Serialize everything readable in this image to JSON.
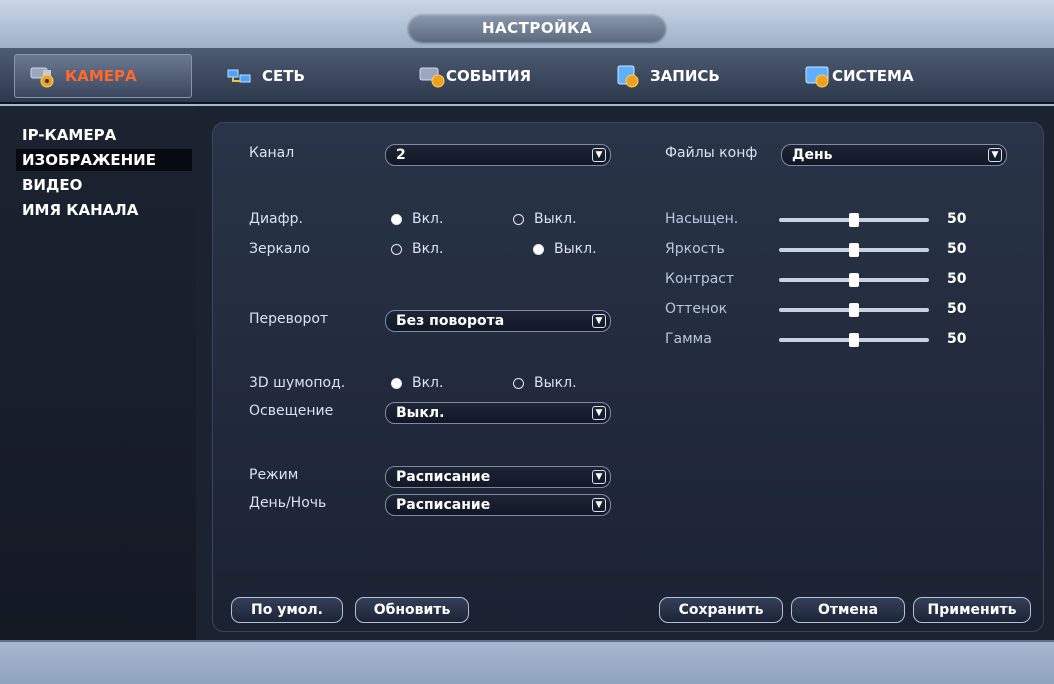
{
  "title": "НАСТРОЙКА",
  "tabs": [
    {
      "label": "КАМЕРА",
      "icon": "camera-icon",
      "active": true
    },
    {
      "label": "СЕТЬ",
      "icon": "network-icon",
      "active": false
    },
    {
      "label": "СОБЫТИЯ",
      "icon": "events-icon",
      "active": false
    },
    {
      "label": "ЗАПИСЬ",
      "icon": "record-icon",
      "active": false
    },
    {
      "label": "СИСТЕМА",
      "icon": "system-icon",
      "active": false
    }
  ],
  "sidebar": {
    "items": [
      {
        "label": "IP-КАМЕРА",
        "active": false
      },
      {
        "label": "ИЗОБРАЖЕНИЕ",
        "active": true
      },
      {
        "label": "ВИДЕО",
        "active": false
      },
      {
        "label": "ИМЯ КАНАЛА",
        "active": false
      }
    ]
  },
  "form": {
    "channel": {
      "label": "Канал",
      "value": "2"
    },
    "aperture": {
      "label": "Диафр.",
      "on": "Вкл.",
      "off": "Выкл.",
      "selected": "on"
    },
    "mirror": {
      "label": "Зеркало",
      "on": "Вкл.",
      "off": "Выкл.",
      "selected": "off"
    },
    "flip": {
      "label": "Переворот",
      "value": "Без поворота"
    },
    "dnr3d": {
      "label": "3D шумопод.",
      "on": "Вкл.",
      "off": "Выкл.",
      "selected": "on"
    },
    "lighting": {
      "label": "Освещение",
      "value": "Выкл."
    },
    "mode": {
      "label": "Режим",
      "value": "Расписание"
    },
    "daynight": {
      "label": "День/Ночь",
      "value": "Расписание"
    },
    "profile": {
      "label": "Файлы конф",
      "value": "День"
    }
  },
  "sliders": [
    {
      "label": "Насыщен.",
      "value": 50
    },
    {
      "label": "Яркость",
      "value": 50
    },
    {
      "label": "Контраст",
      "value": 50
    },
    {
      "label": "Оттенок",
      "value": 50
    },
    {
      "label": "Гамма",
      "value": 50
    }
  ],
  "buttons": {
    "default": "По умол.",
    "refresh": "Обновить",
    "save": "Сохранить",
    "cancel": "Отмена",
    "apply": "Применить"
  },
  "colors": {
    "active_tab_text": "#ff6a2a",
    "panel_bg": "#1a2232",
    "accent": "#ffffff"
  }
}
